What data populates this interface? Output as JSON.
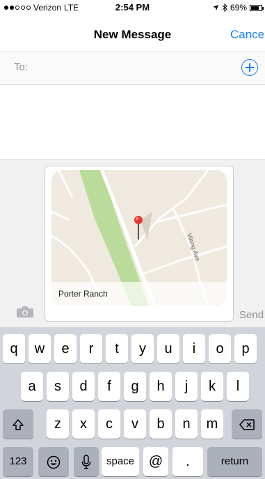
{
  "status": {
    "carrier": "Verizon",
    "network": "LTE",
    "time": "2:54 PM",
    "battery": "69%"
  },
  "nav": {
    "title": "New Message",
    "cancel_label": "Cancel"
  },
  "to": {
    "label": "To:"
  },
  "map": {
    "place": "Porter Ranch",
    "street": "Viking Ave"
  },
  "compose": {
    "send_label": "Send"
  },
  "keyboard": {
    "row1": [
      "q",
      "w",
      "e",
      "r",
      "t",
      "y",
      "u",
      "i",
      "o",
      "p"
    ],
    "row2": [
      "a",
      "s",
      "d",
      "f",
      "g",
      "h",
      "j",
      "k",
      "l"
    ],
    "row3": [
      "z",
      "x",
      "c",
      "v",
      "b",
      "n",
      "m"
    ],
    "numbers_label": "123",
    "space_label": "space",
    "at_label": "@",
    "dot_label": ".",
    "return_label": "return"
  }
}
